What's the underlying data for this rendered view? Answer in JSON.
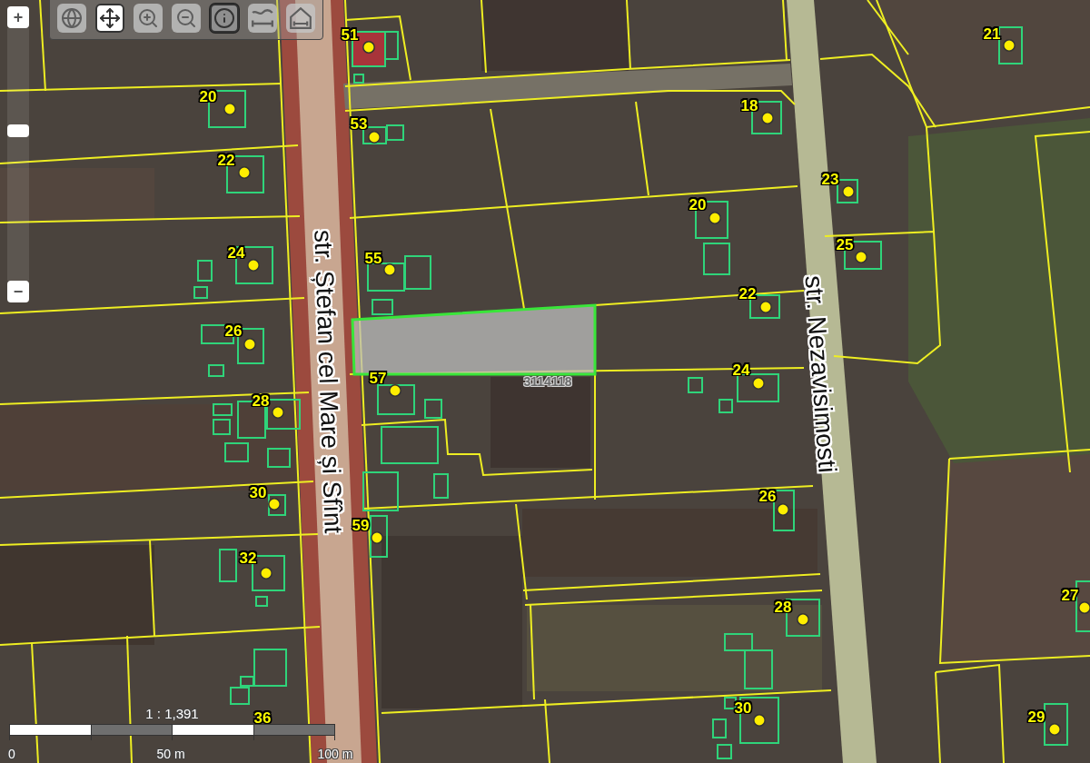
{
  "toolbar": {
    "tools": [
      {
        "kind": "globe",
        "selected": false,
        "focused": false
      },
      {
        "kind": "pan",
        "selected": true,
        "focused": false
      },
      {
        "kind": "zoom_in",
        "selected": false,
        "focused": false
      },
      {
        "kind": "zoom_out",
        "selected": false,
        "focused": false
      },
      {
        "kind": "identify",
        "selected": false,
        "focused": true
      },
      {
        "kind": "measure_line",
        "selected": false,
        "focused": false
      },
      {
        "kind": "measure_area",
        "selected": false,
        "focused": false
      }
    ]
  },
  "zoom": {
    "zoom_in": "+",
    "zoom_out": "−",
    "level": 0.6
  },
  "map": {
    "streets": [
      "str. Ștefan cel Mare și Sfînt",
      "str. Nezavisimosti"
    ],
    "parcel_number": "3114118",
    "house_numbers": [
      "51",
      "21",
      "20",
      "18",
      "53",
      "22",
      "23",
      "20",
      "25",
      "24",
      "55",
      "22",
      "26",
      "24",
      "57",
      "28",
      "30",
      "26",
      "59",
      "32",
      "27",
      "28",
      "30",
      "36",
      "29"
    ]
  },
  "scale": {
    "ratio": "1 : 1,391",
    "labels": [
      "0",
      "50 m",
      "100 m"
    ]
  }
}
